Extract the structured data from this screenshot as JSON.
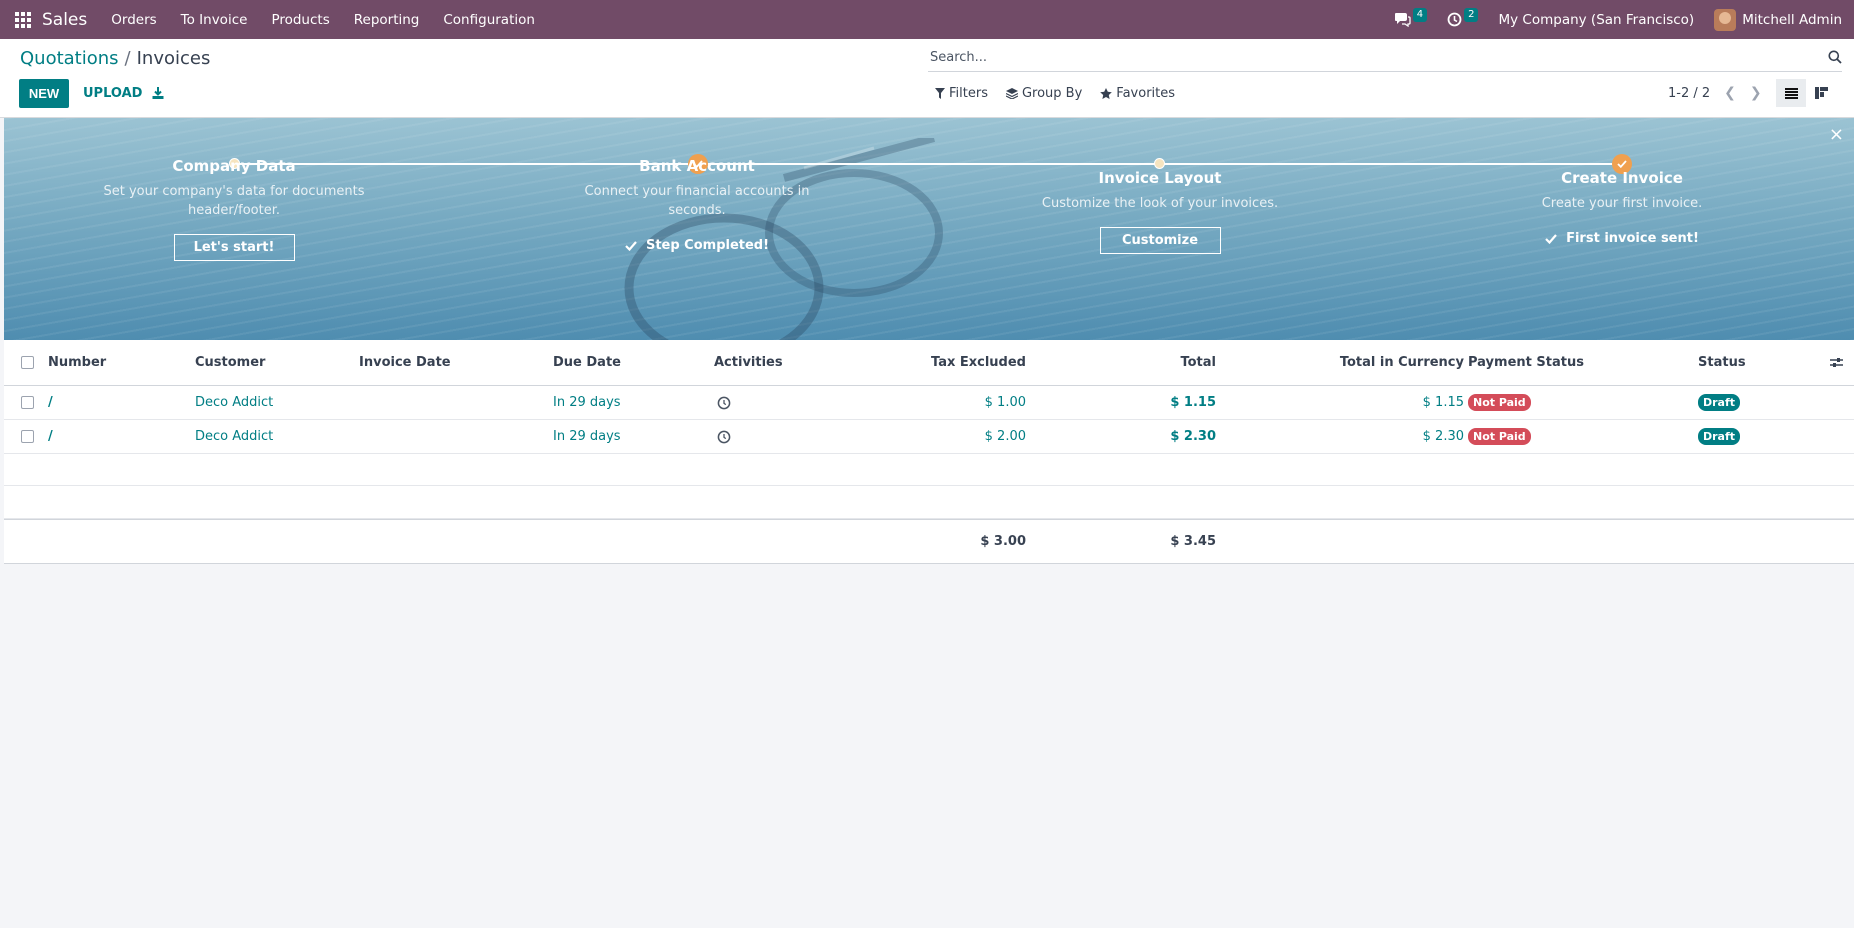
{
  "navbar": {
    "app_name": "Sales",
    "menu": [
      "Orders",
      "To Invoice",
      "Products",
      "Reporting",
      "Configuration"
    ],
    "messages_count": "4",
    "activities_count": "2",
    "company": "My Company (San Francisco)",
    "user": "Mitchell Admin",
    "brand_color": "#714b67"
  },
  "breadcrumb": {
    "parent": "Quotations",
    "separator": "/",
    "current": "Invoices"
  },
  "actions": {
    "new_label": "NEW",
    "upload_label": "UPLOAD"
  },
  "search": {
    "placeholder": "Search..."
  },
  "filters": {
    "filters_label": "Filters",
    "groupby_label": "Group By",
    "favorites_label": "Favorites"
  },
  "pager": {
    "value": "1-2 / 2"
  },
  "onboarding": {
    "close": "×",
    "steps": [
      {
        "title": "Company Data",
        "desc": "Set your company's data for documents header/footer.",
        "action": "Let's start!",
        "done": false
      },
      {
        "title": "Bank Account",
        "desc": "Connect your financial accounts in seconds.",
        "action": "Step Completed!",
        "done": true
      },
      {
        "title": "Invoice Layout",
        "desc": "Customize the look of your invoices.",
        "action": "Customize",
        "done": false
      },
      {
        "title": "Create Invoice",
        "desc": "Create your first invoice.",
        "action": "First invoice sent!",
        "done": true
      }
    ]
  },
  "table": {
    "columns": [
      "Number",
      "Customer",
      "Invoice Date",
      "Due Date",
      "Activities",
      "Tax Excluded",
      "Total",
      "Total in Currency",
      "Payment Status",
      "Status"
    ],
    "rows": [
      {
        "number": "/",
        "customer": "Deco Addict",
        "invoice_date": "",
        "due_date": "In 29 days",
        "tax_excluded": "$ 1.00",
        "total": "$ 1.15",
        "total_currency": "$ 1.15",
        "payment_status": "Not Paid",
        "status": "Draft"
      },
      {
        "number": "/",
        "customer": "Deco Addict",
        "invoice_date": "",
        "due_date": "In 29 days",
        "tax_excluded": "$ 2.00",
        "total": "$ 2.30",
        "total_currency": "$ 2.30",
        "payment_status": "Not Paid",
        "status": "Draft"
      }
    ],
    "totals": {
      "tax_excluded": "$ 3.00",
      "total": "$ 3.45"
    }
  }
}
